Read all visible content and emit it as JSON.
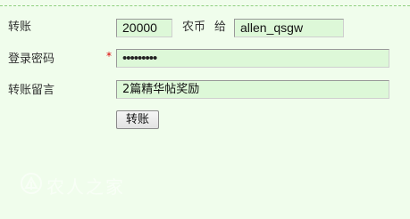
{
  "form": {
    "transfer_label": "转账",
    "amount_value": "20000",
    "currency_label": "农币",
    "to_label": "给",
    "recipient_value": "allen_qsgw",
    "password_label": "登录密码",
    "required_mark": "*",
    "password_value": "•••••••••",
    "message_label": "转账留言",
    "message_value": "2篇精华帖奖励",
    "submit_label": "转账"
  },
  "watermark": {
    "text": "农人之家",
    "icon": "farm-logo-icon"
  }
}
